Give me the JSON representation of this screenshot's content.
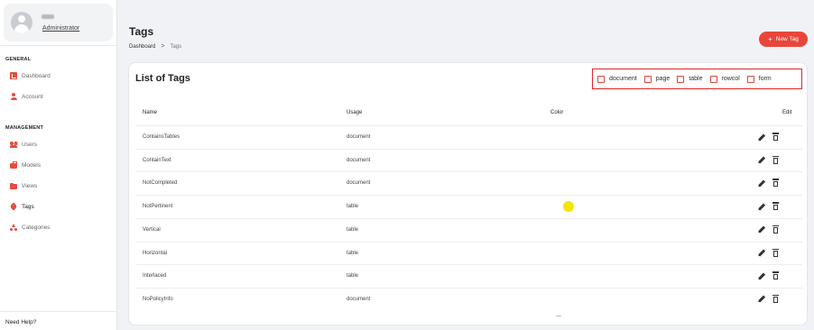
{
  "user": {
    "role": "Administrator"
  },
  "sidebar": {
    "general_label": "GENERAL",
    "management_label": "MANAGEMENT",
    "general_items": [
      {
        "label": "Dashboard",
        "icon": "dashboard-icon"
      },
      {
        "label": "Account",
        "icon": "account-icon"
      }
    ],
    "management_items": [
      {
        "label": "Users",
        "icon": "users-icon"
      },
      {
        "label": "Models",
        "icon": "models-icon"
      },
      {
        "label": "Views",
        "icon": "folder-icon"
      },
      {
        "label": "Tags",
        "icon": "tag-icon",
        "active": true
      },
      {
        "label": "Categories",
        "icon": "categories-icon"
      }
    ],
    "help": "Need Help?"
  },
  "header": {
    "title": "Tags",
    "breadcrumb": [
      "Dashboard",
      "Tags"
    ],
    "breadcrumb_sep": ">",
    "new_button": "New Tag",
    "new_button_icon": "+"
  },
  "card": {
    "title": "List of Tags",
    "filters": [
      "document",
      "page",
      "table",
      "rowcol",
      "form"
    ],
    "columns": {
      "name": "Name",
      "usage": "Usage",
      "color": "Color",
      "edit": "Edit"
    },
    "rows": [
      {
        "name": "ContainsTables",
        "usage": "document",
        "color": ""
      },
      {
        "name": "ContainText",
        "usage": "document",
        "color": ""
      },
      {
        "name": "NotCompleted",
        "usage": "document",
        "color": ""
      },
      {
        "name": "NotPertinent",
        "usage": "table",
        "color": "#f2e600"
      },
      {
        "name": "Vertical",
        "usage": "table",
        "color": ""
      },
      {
        "name": "Horizontal",
        "usage": "table",
        "color": ""
      },
      {
        "name": "Interlaced",
        "usage": "table",
        "color": ""
      },
      {
        "name": "NoPolicyInfo",
        "usage": "document",
        "color": ""
      }
    ]
  },
  "colors": {
    "accent": "#e9463b",
    "filter_border": "#e02424"
  }
}
